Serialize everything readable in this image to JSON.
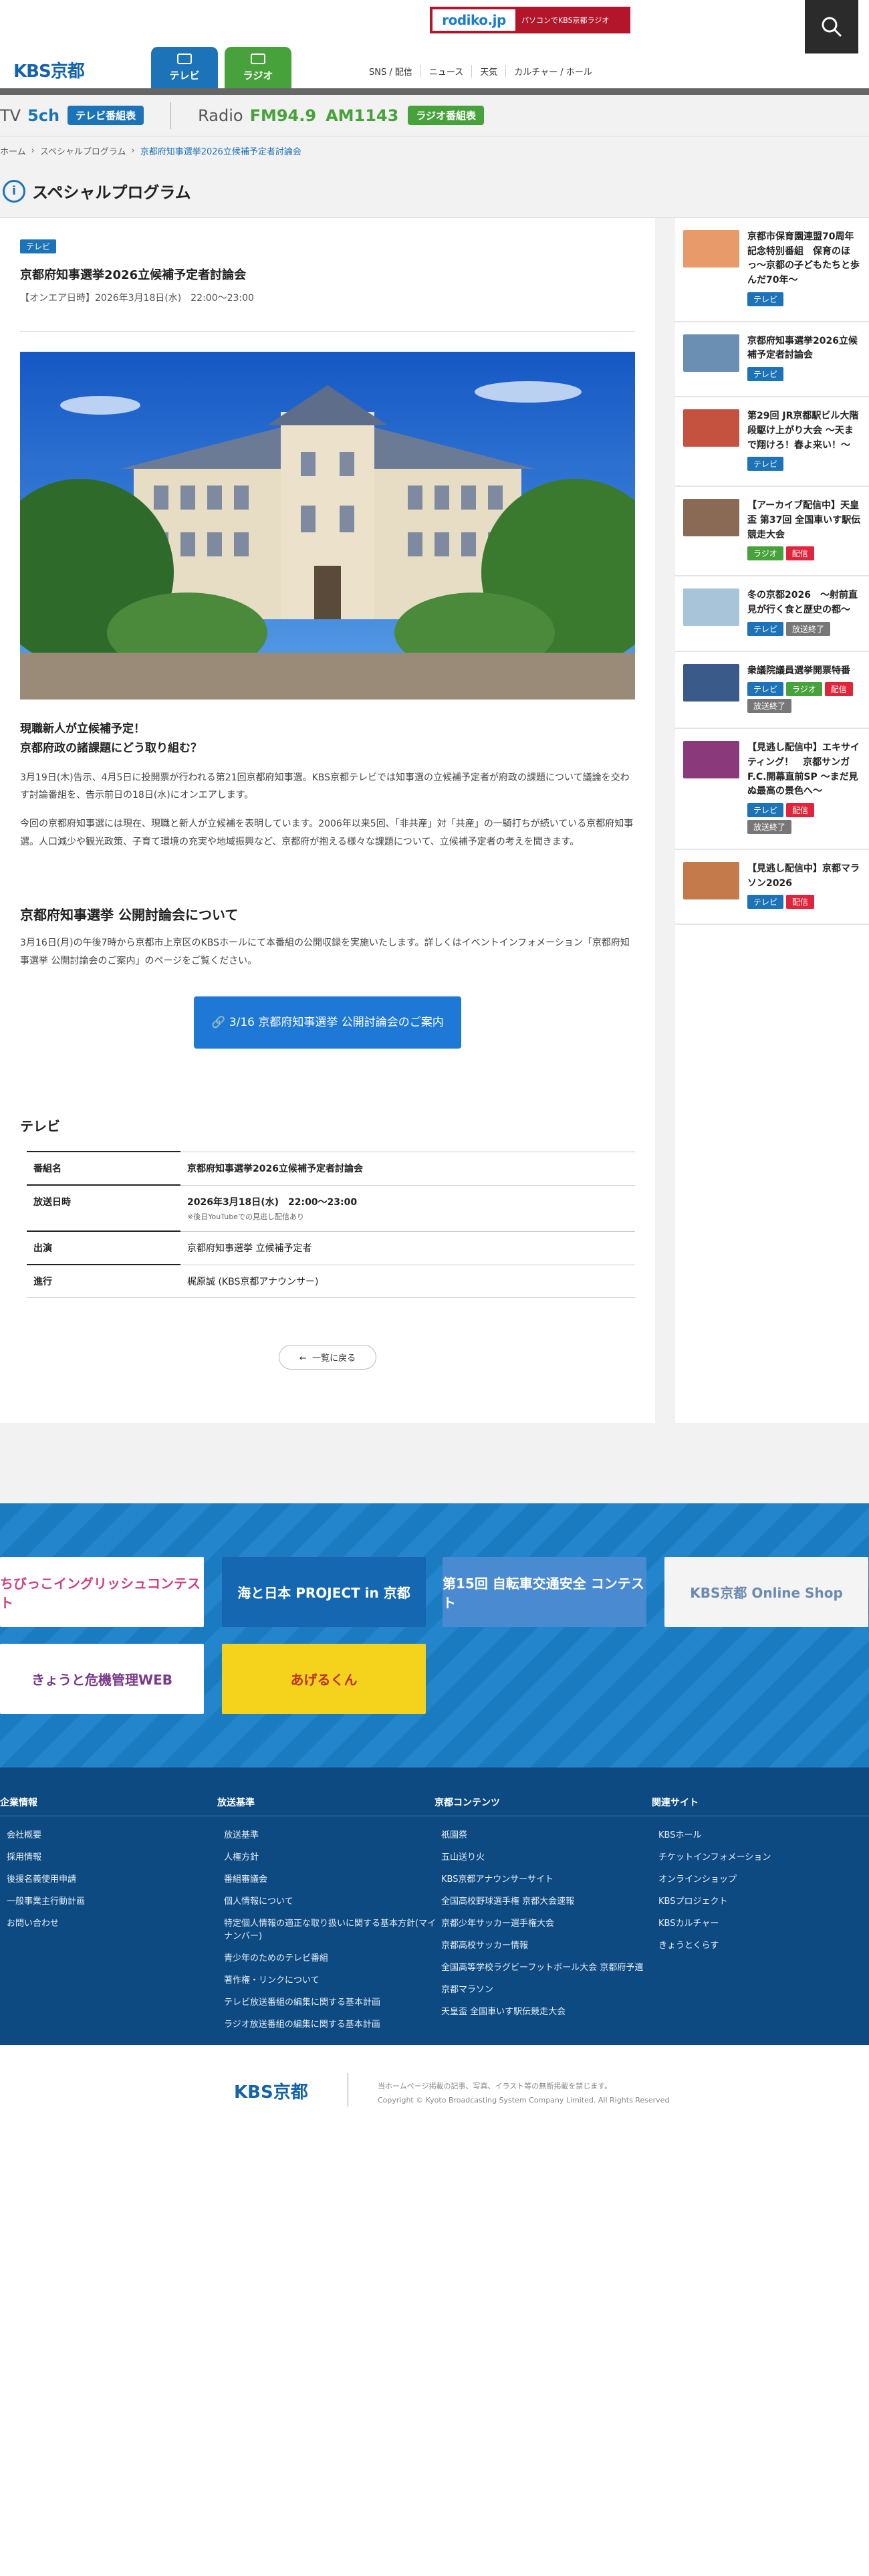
{
  "header": {
    "radiko_logo": "rodiko.jp",
    "radiko_caption": "パソコンでKBS京都ラジオ",
    "site_logo": "KBS京都",
    "nav_tv": "テレビ",
    "nav_radio": "ラジオ",
    "gnav": [
      "SNS / 配信",
      "ニュース",
      "天気",
      "カルチャー / ホール"
    ]
  },
  "channel_bar": {
    "tv_label": "TV",
    "tv_channel": "5ch",
    "tv_button": "テレビ番組表",
    "radio_label": "Radio",
    "fm": "FM94.9",
    "am": "AM1143",
    "radio_button": "ラジオ番組表"
  },
  "breadcrumb": [
    "ホーム",
    "スペシャルプログラム",
    "京都府知事選挙2026立候補予定者討論会"
  ],
  "section_title": "スペシャルプログラム",
  "article": {
    "badge": "テレビ",
    "title": "京都府知事選挙2026立候補予定者討論会",
    "date": "【オンエア日時】2026年3月18日(水)　22:00〜23:00",
    "intro_line1": "現職新人が立候補予定！",
    "intro_line2": "京都府政の諸課題にどう取り組む？",
    "p1": "3月19日(木)告示、4月5日に投開票が行われる第21回京都府知事選。KBS京都テレビでは知事選の立候補予定者が府政の課題について議論を交わす討論番組を、告示前日の18日(水)にオンエアします。",
    "p2": "今回の京都府知事選には現在、現職と新人が立候補を表明しています。2006年以来5回、「非共産」対「共産」の一騎打ちが続いている京都府知事選。人口減少や観光政策、子育て環境の充実や地域振興など、京都府が抱える様々な課題について、立候補予定者の考えを聞きます。",
    "h2": "京都府知事選挙 公開討論会について",
    "p3": "3月16日(月)の午後7時から京都市上京区のKBSホールにて本番組の公開収録を実施いたします。詳しくはイベントインフォメーション「京都府知事選挙 公開討論会のご案内」のページをご覧ください。",
    "cta": "3/16 京都府知事選挙 公開討論会のご案内",
    "h3": "テレビ",
    "table": [
      {
        "k": "番組名",
        "v": "京都府知事選挙2026立候補予定者討論会",
        "bold": true
      },
      {
        "k": "放送日時",
        "v": "2026年3月18日(水)　22:00〜23:00",
        "note": "※後日YouTubeでの見逃し配信あり",
        "bold": true
      },
      {
        "k": "出演",
        "v": "京都府知事選挙 立候補予定者"
      },
      {
        "k": "進行",
        "v": "梶原誠 (KBS京都アナウンサー)"
      }
    ],
    "back": "一覧に戻る"
  },
  "sidebar": [
    {
      "title": "京都市保育園連盟70周年記念特別番組　保育のほっ〜京都の子どもたちと歩んだ70年〜",
      "badges": [
        [
          "テレビ",
          "tv"
        ]
      ],
      "color": "#e89a6a"
    },
    {
      "title": "京都府知事選挙2026立候補予定者討論会",
      "badges": [
        [
          "テレビ",
          "tv"
        ]
      ],
      "color": "#6b8fb3"
    },
    {
      "title": "第29回 JR京都駅ビル大階段駆け上がり大会 〜天まで翔けろ！春よ来い！〜",
      "badges": [
        [
          "テレビ",
          "tv"
        ]
      ],
      "color": "#c4523e"
    },
    {
      "title": "【アーカイブ配信中】天皇盃 第37回 全国車いす駅伝競走大会",
      "badges": [
        [
          "ラジオ",
          "radio"
        ],
        [
          "配信",
          "stream"
        ]
      ],
      "color": "#8a6a54"
    },
    {
      "title": "冬の京都2026　〜射前直見が行く食と歴史の都〜",
      "badges": [
        [
          "テレビ",
          "tv"
        ],
        [
          "放送終了",
          "dist"
        ]
      ],
      "color": "#a8c4d8"
    },
    {
      "title": "衆議院議員選挙開票特番",
      "badges": [
        [
          "テレビ",
          "tv"
        ],
        [
          "ラジオ",
          "radio"
        ],
        [
          "配信",
          "stream"
        ],
        [
          "放送終了",
          "dist"
        ]
      ],
      "color": "#3a5a8a"
    },
    {
      "title": "【見逃し配信中】エキサイティング！　京都サンガF.C.開幕直前SP 〜まだ見ぬ最高の景色へ〜",
      "badges": [
        [
          "テレビ",
          "tv"
        ],
        [
          "配信",
          "stream"
        ],
        [
          "放送終了",
          "dist"
        ]
      ],
      "color": "#8a3a7a"
    },
    {
      "title": "【見逃し配信中】京都マラソン2026",
      "badges": [
        [
          "テレビ",
          "tv"
        ],
        [
          "配信",
          "stream"
        ]
      ],
      "color": "#c47a4a"
    }
  ],
  "banners": [
    {
      "label": "ちびっこイングリッシュコンテスト",
      "bg": "#ffffff",
      "fg": "#d04080"
    },
    {
      "label": "海と日本 PROJECT in 京都",
      "bg": "#1467b0",
      "fg": "#ffffff"
    },
    {
      "label": "第15回 自転車交通安全 コンテスト",
      "bg": "#4a8ad0",
      "fg": "#ffffff"
    },
    {
      "label": "KBS京都 Online Shop",
      "bg": "#f4f4f4",
      "fg": "#6a8ab0"
    },
    {
      "label": "きょうと危機管理WEB",
      "bg": "#ffffff",
      "fg": "#7a3a8a"
    },
    {
      "label": "あげるくん",
      "bg": "#f5d21c",
      "fg": "#c03020"
    }
  ],
  "footer": {
    "cols": [
      {
        "head": "企業情報",
        "items": [
          "会社概要",
          "採用情報",
          "後援名義使用申請",
          "一般事業主行動計画",
          "お問い合わせ"
        ]
      },
      {
        "head": "放送基準",
        "items": [
          "放送基準",
          "人権方針",
          "番組審議会",
          "個人情報について",
          "特定個人情報の適正な取り扱いに関する基本方針(マイナンバー)",
          "青少年のためのテレビ番組",
          "著作権・リンクについて",
          "テレビ放送番組の編集に関する基本計画",
          "ラジオ放送番組の編集に関する基本計画"
        ]
      },
      {
        "head": "京都コンテンツ",
        "items": [
          "祇園祭",
          "五山送り火",
          "KBS京都アナウンサーサイト",
          "全国高校野球選手権 京都大会速報",
          "京都少年サッカー選手権大会",
          "京都高校サッカー情報",
          "全国高等学校ラグビーフットボール大会 京都府予選",
          "京都マラソン",
          "天皇盃 全国車いす駅伝競走大会"
        ]
      },
      {
        "head": "関連サイト",
        "items": [
          "KBSホール",
          "チケットインフォメーション",
          "オンラインショップ",
          "KBSプロジェクト",
          "KBSカルチャー",
          "きょうとくらす"
        ]
      }
    ],
    "logo": "KBS京都",
    "notice": "当ホームページ掲載の記事、写真、イラスト等の無断掲載を禁じます。",
    "copyright": "Copyright © Kyoto Broadcasting System Company Limited. All Rights Reserved"
  }
}
